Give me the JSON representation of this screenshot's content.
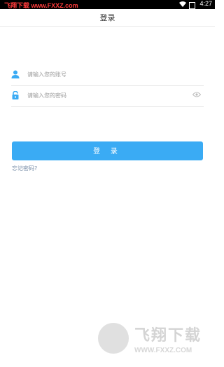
{
  "status_bar": {
    "watermark": "飞翔下载 www.FXXZ.com",
    "time": "4:27"
  },
  "header": {
    "title": "登录"
  },
  "form": {
    "account_placeholder": "请输入您的账号",
    "password_placeholder": "请输入您的密码",
    "login_label": "登 录",
    "forgot_label": "忘记密码?"
  },
  "watermark": {
    "brand": "飞翔下载",
    "url": "WWW.FXXZ.COM"
  },
  "colors": {
    "accent": "#3aabf4",
    "text": "#333333",
    "placeholder": "#9a9a9a"
  }
}
